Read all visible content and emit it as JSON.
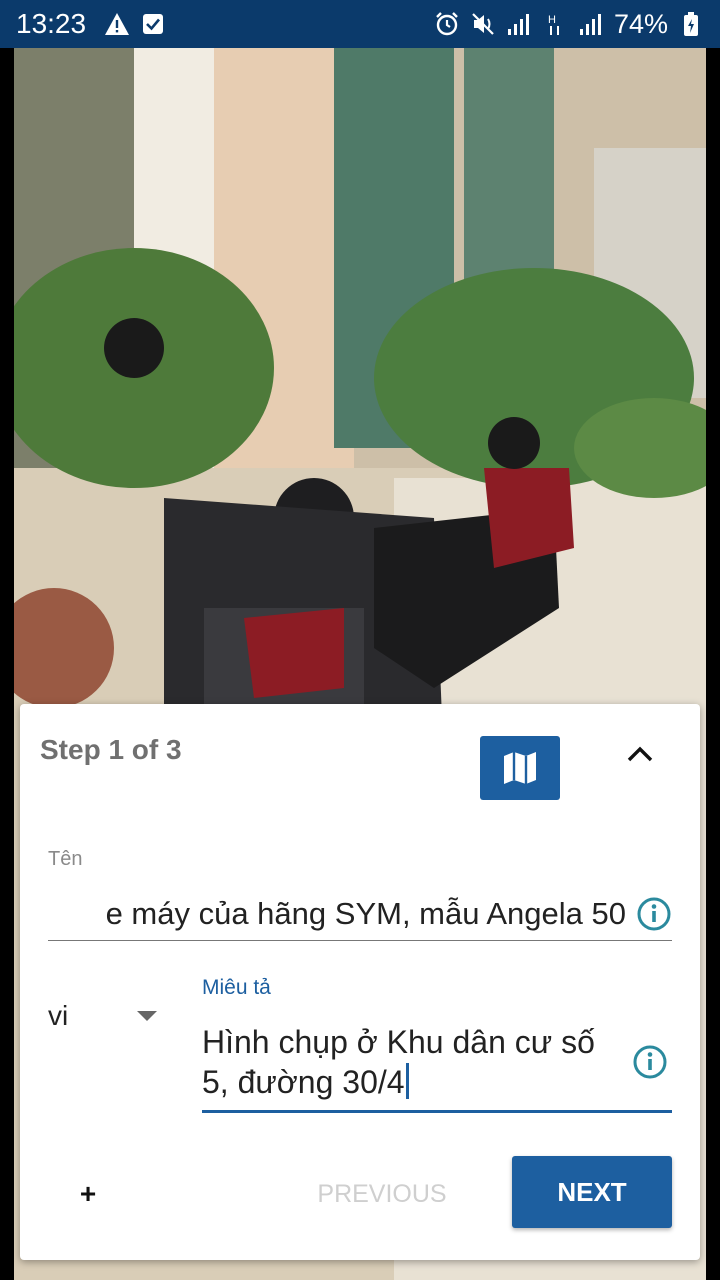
{
  "status_bar": {
    "time": "13:23",
    "battery": "74%"
  },
  "card": {
    "step_title": "Step 1 of 3",
    "name_label": "Tên",
    "name_value": "e máy của hãng SYM, mẫu Angela 50",
    "language_value": "vi",
    "description_label": "Miêu tả",
    "description_value": "Hình chụp ở Khu dân cư số 5, đường 30/4",
    "add_label": "+",
    "previous_label": "PREVIOUS",
    "next_label": "NEXT"
  },
  "icons": {
    "map": "map-icon",
    "collapse": "chevron-up-icon",
    "info": "info-icon",
    "dropdown": "caret-down-icon"
  },
  "colors": {
    "status_bar": "#0b3a6b",
    "accent": "#1d5fa0",
    "info": "#2b8a9e",
    "disabled_text": "#cfcfcf"
  }
}
